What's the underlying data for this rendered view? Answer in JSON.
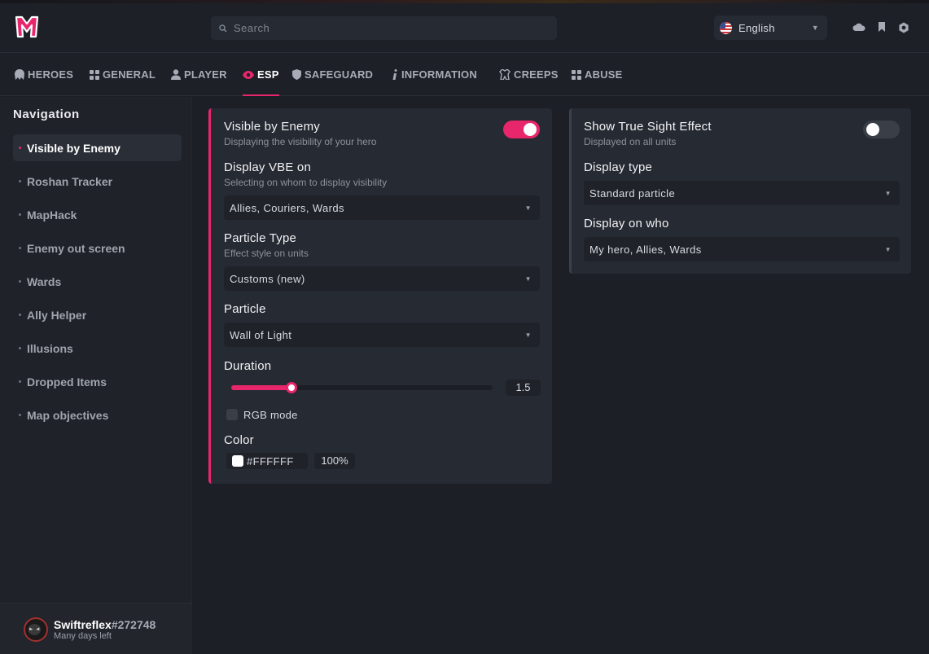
{
  "header": {
    "search_placeholder": "Search",
    "language": "English",
    "icons": [
      "cloud-icon",
      "bookmark-icon",
      "settings-icon"
    ]
  },
  "tabs": [
    {
      "label": "HEROES",
      "icon": "helmet-icon"
    },
    {
      "label": "GENERAL",
      "icon": "grid-icon"
    },
    {
      "label": "PLAYER",
      "icon": "user-icon"
    },
    {
      "label": "ESP",
      "icon": "eye-icon",
      "active": true
    },
    {
      "label": "SAFEGUARD",
      "icon": "shield-icon"
    },
    {
      "label": "INFORMATION",
      "icon": "info-icon"
    },
    {
      "label": "CREEPS",
      "icon": "creep-icon"
    },
    {
      "label": "ABUSE",
      "icon": "grid-icon"
    }
  ],
  "sidebar": {
    "title": "Navigation",
    "items": [
      {
        "label": "Visible by Enemy",
        "active": true
      },
      {
        "label": "Roshan Tracker"
      },
      {
        "label": "MapHack"
      },
      {
        "label": "Enemy out screen"
      },
      {
        "label": "Wards"
      },
      {
        "label": "Ally Helper"
      },
      {
        "label": "Illusions"
      },
      {
        "label": "Dropped Items"
      },
      {
        "label": "Map objectives"
      }
    ],
    "user": {
      "name": "Swiftreflex",
      "tag": "#272748",
      "subtitle": "Many days left"
    }
  },
  "left_panel": {
    "vbe": {
      "label": "Visible by Enemy",
      "desc": "Displaying the visibility of your hero",
      "enabled": true
    },
    "display_vbe_on": {
      "label": "Display VBE on",
      "desc": "Selecting on whom to display visibility",
      "value": "Allies, Couriers, Wards"
    },
    "particle_type": {
      "label": "Particle Type",
      "desc": "Effect style on units",
      "value": "Customs (new)"
    },
    "particle": {
      "label": "Particle",
      "value": "Wall of Light"
    },
    "duration": {
      "label": "Duration",
      "value": "1.5",
      "fraction": 0.23
    },
    "rgb_mode": {
      "label": "RGB mode",
      "checked": false
    },
    "color": {
      "label": "Color",
      "hex": "#FFFFFF",
      "alpha": "100%"
    }
  },
  "right_panel": {
    "true_sight": {
      "label": "Show True Sight Effect",
      "desc": "Displayed on all units",
      "enabled": false
    },
    "display_type": {
      "label": "Display type",
      "value": "Standard particle"
    },
    "display_on_who": {
      "label": "Display on who",
      "value": "My hero, Allies, Wards"
    }
  },
  "colors": {
    "accent": "#e8266b",
    "background": "#1c1f26",
    "panel": "#262a32"
  }
}
